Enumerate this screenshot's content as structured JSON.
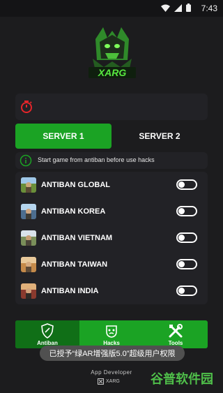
{
  "status_bar": {
    "time": "7:43"
  },
  "logo": {
    "text": "XARG"
  },
  "tabs": [
    {
      "label": "SERVER 1",
      "active": true
    },
    {
      "label": "SERVER 2",
      "active": false
    }
  ],
  "notice": {
    "text": "Start game from antiban before use hacks"
  },
  "antiban_items": [
    {
      "label": "ANTIBAN GLOBAL",
      "enabled": false
    },
    {
      "label": "ANTIBAN KOREA",
      "enabled": false
    },
    {
      "label": "ANTIBAN VIETNAM",
      "enabled": false
    },
    {
      "label": "ANTIBAN TAIWAN",
      "enabled": false
    },
    {
      "label": "ANTIBAN INDIA",
      "enabled": false
    }
  ],
  "bottom_nav": [
    {
      "label": "Antiban",
      "icon": "shield-icon",
      "active": true
    },
    {
      "label": "Hacks",
      "icon": "ghost-mask-icon",
      "active": false
    },
    {
      "label": "Tools",
      "icon": "tools-icon",
      "active": false
    }
  ],
  "toast": {
    "text": "已授予“绿AR增强版5.0”超级用户权限"
  },
  "footer": {
    "developer_label": "App Developer",
    "brand": "XARG"
  },
  "watermark": {
    "text": "谷普软件园"
  },
  "colors": {
    "accent": "#1ba324",
    "accent_dark": "#106f17",
    "background": "#1c1c1e",
    "card": "#222226",
    "timer": "#e5252a"
  }
}
